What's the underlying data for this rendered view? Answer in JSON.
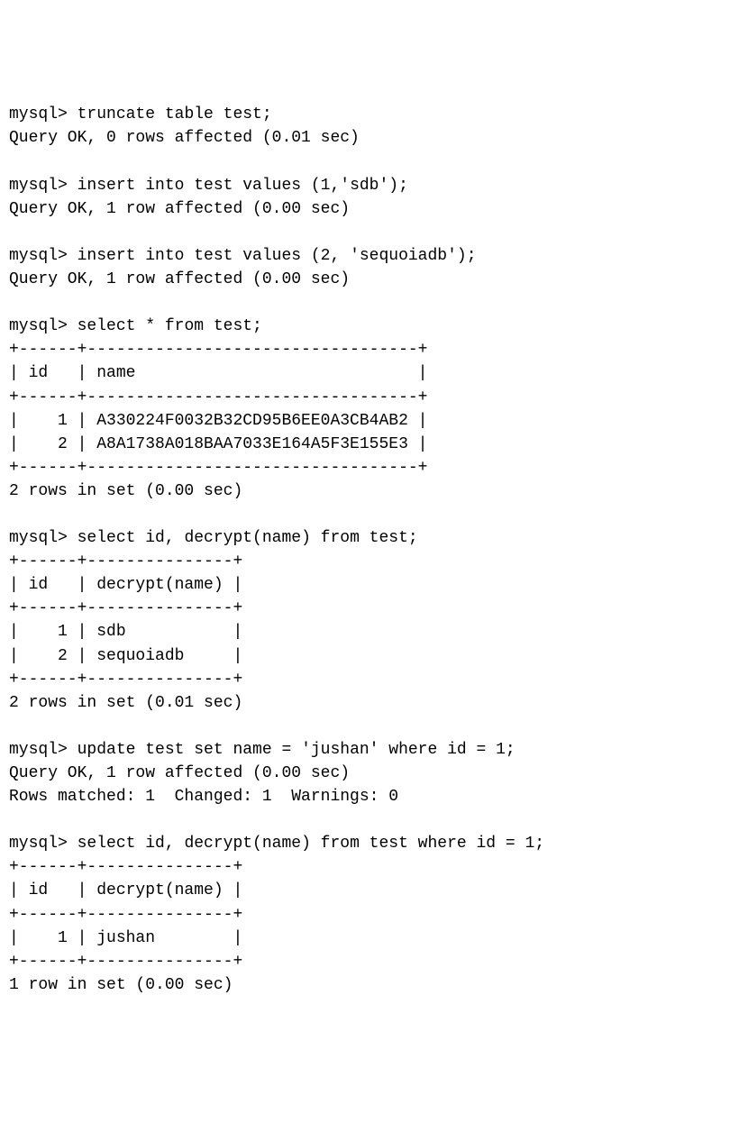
{
  "prompt": "mysql>",
  "blocks": [
    {
      "command": "truncate table test;",
      "response": "Query OK, 0 rows affected (0.01 sec)"
    },
    {
      "command": "insert into test values (1,'sdb');",
      "response": "Query OK, 1 row affected (0.00 sec)"
    },
    {
      "command": "insert into test values (2, 'sequoiadb');",
      "response": "Query OK, 1 row affected (0.00 sec)"
    },
    {
      "command": "select * from test;",
      "table": {
        "border": "+------+----------------------------------+",
        "header": "| id   | name                             |",
        "rows": [
          "|    1 | A330224F0032B32CD95B6EE0A3CB4AB2 |",
          "|    2 | A8A1738A018BAA7033E164A5F3E155E3 |"
        ]
      },
      "footer": "2 rows in set (0.00 sec)"
    },
    {
      "command": "select id, decrypt(name) from test;",
      "table": {
        "border": "+------+---------------+",
        "header": "| id   | decrypt(name) |",
        "rows": [
          "|    1 | sdb           |",
          "|    2 | sequoiadb     |"
        ]
      },
      "footer": "2 rows in set (0.01 sec)"
    },
    {
      "command": "update test set name = 'jushan' where id = 1;",
      "response": "Query OK, 1 row affected (0.00 sec)\nRows matched: 1  Changed: 1  Warnings: 0"
    },
    {
      "command": "select id, decrypt(name) from test where id = 1;",
      "table": {
        "border": "+------+---------------+",
        "header": "| id   | decrypt(name) |",
        "rows": [
          "|    1 | jushan        |"
        ]
      },
      "footer": "1 row in set (0.00 sec)"
    }
  ]
}
